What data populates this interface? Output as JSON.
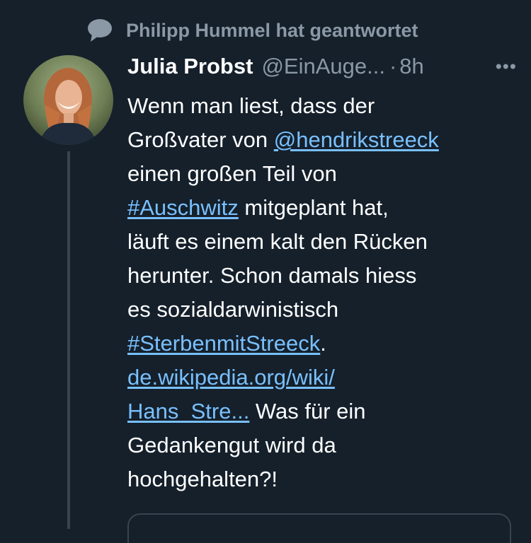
{
  "context": {
    "icon": "speech-bubble-icon",
    "text": "Philipp Hummel hat geantwortet"
  },
  "tweet": {
    "author_name": "Julia Probst",
    "author_handle": "@EinAuge...",
    "separator": "·",
    "time": "8h",
    "more_icon": "more-dots-icon",
    "more_label": "•••",
    "body": {
      "line1": "Wenn man liest, dass der",
      "line2_text": "Großvater von ",
      "mention": "@hendrikstreeck",
      "line3": "einen großen Teil von",
      "hashtag1": "#Auschwitz",
      "line4_rest": " mitgeplant hat,",
      "line5": "läuft es einem kalt den Rücken",
      "line6": "herunter. Schon damals hiess",
      "line7": "es sozialdarwinistisch",
      "hashtag2": "#SterbenmitStreeck",
      "line8_rest": ".",
      "link_part1": "de.wikipedia.org/wiki/",
      "link_part2": "Hans_Stre...",
      "line10_rest": " Was für ein",
      "line11": "Gedankengut wird da",
      "line12": "hochgehalten?!"
    }
  },
  "colors": {
    "background": "#15202b",
    "secondary_text": "#8b98a5",
    "link": "#79c0ff",
    "thread_line": "#38444d"
  }
}
